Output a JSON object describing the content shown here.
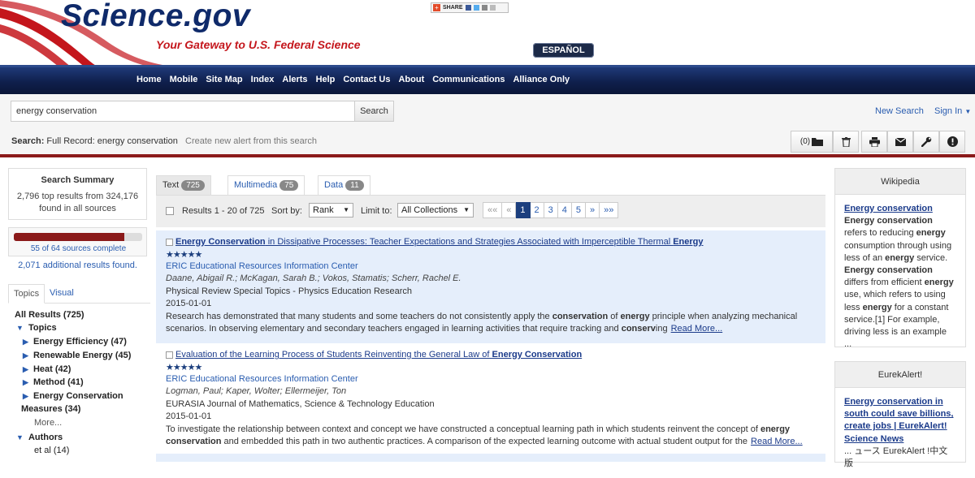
{
  "site": {
    "logo": "Science.gov",
    "tagline": "Your Gateway to U.S. Federal Science",
    "share_label": "SHARE",
    "espanol": "ESPAÑOL"
  },
  "nav": [
    "Home",
    "Mobile",
    "Site Map",
    "Index",
    "Alerts",
    "Help",
    "Contact Us",
    "About",
    "Communications",
    "Alliance Only"
  ],
  "search": {
    "query": "energy conservation",
    "button": "Search",
    "new_search": "New Search",
    "sign_in": "Sign In",
    "label_prefix": "Search:",
    "label_value": "Full Record: energy conservation",
    "create_alert": "Create new alert from this search",
    "saved_count": "(0)"
  },
  "colors": {
    "brand_navy": "#0f2a6a",
    "accent_red": "#c4161c",
    "divider": "#8b1a1a",
    "link": "#2a5db0",
    "highlight": "#e5eefb"
  },
  "toolbar_icons": [
    "folder-icon",
    "trash-icon",
    "print-icon",
    "email-icon",
    "wrench-icon",
    "info-icon"
  ],
  "summary": {
    "title": "Search Summary",
    "text": "2,796 top results from 324,176 found in all sources",
    "progress_text": "55 of 64 sources complete",
    "progress_fraction": 0.86,
    "additional": "2,071 additional results found."
  },
  "side_tabs": [
    "Topics",
    "Visual"
  ],
  "facets": {
    "all_results": "All Results (725)",
    "topics_label": "Topics",
    "topics": [
      "Energy Efficiency (47)",
      "Renewable Energy (45)",
      "Heat (42)",
      "Method (41)",
      "Energy Conservation"
    ],
    "topics_wrap": "Measures (34)",
    "more": "More...",
    "authors_label": "Authors",
    "authors": [
      "et al (14)"
    ]
  },
  "result_tabs": [
    {
      "label": "Text",
      "count": "725"
    },
    {
      "label": "Multimedia",
      "count": "75"
    },
    {
      "label": "Data",
      "count": "11"
    }
  ],
  "results_bar": {
    "count": "Results 1 - 20 of 725",
    "sort_label": "Sort by:",
    "sort_value": "Rank",
    "limit_label": "Limit to:",
    "limit_value": "All Collections",
    "pages": [
      "««",
      "«",
      "1",
      "2",
      "3",
      "4",
      "5",
      "»",
      "»»"
    ],
    "active_page": "1"
  },
  "results": [
    {
      "title_b1": "Energy Conservation",
      "title_mid": " in Dissipative Processes: Teacher Expectations and Strategies Associated with Imperceptible Thermal ",
      "title_b2": "Energy",
      "title_end": "",
      "stars": "★★★★★",
      "source": "ERIC Educational Resources Information Center",
      "authors": "Daane, Abigail R.; McKagan, Sarah B.; Vokos, Stamatis; Scherr, Rachel E.",
      "journal": "Physical Review Special Topics - Physics Education Research",
      "date": "2015-01-01",
      "abs1": "Research has demonstrated that many students and some teachers do not consistently apply the ",
      "abs_b1": "conservation",
      "abs2": " of ",
      "abs_b2": "energy",
      "abs3": " principle when analyzing mechanical scenarios. In observing elementary and secondary teachers engaged in learning activities that require tracking and ",
      "abs_b3": "conserv",
      "abs4": "ing",
      "read_more": "Read More..."
    },
    {
      "title_b1": "",
      "title_mid": "Evaluation of the Learning Process of Students Reinventing the General Law of ",
      "title_b2": "Energy Conservation",
      "title_end": "",
      "stars": "★★★★★",
      "source": "ERIC Educational Resources Information Center",
      "authors": "Logman, Paul; Kaper, Wolter; Ellermeijer, Ton",
      "journal": "EURASIA Journal of Mathematics, Science & Technology Education",
      "date": "2015-01-01",
      "abs1": "To investigate the relationship between context and concept we have constructed a conceptual learning path in which students reinvent the concept of ",
      "abs_b1": "energy conservation",
      "abs2": " and embedded this path in two authentic practices. A comparison of the expected learning outcome with actual student output for the",
      "abs_b2": "",
      "abs3": "",
      "abs_b3": "",
      "abs4": "",
      "read_more": "Read More..."
    }
  ],
  "wikipedia": {
    "title": "Wikipedia",
    "link": "Energy conservation",
    "t1b": "Energy conservation",
    "t1": " refers to reducing ",
    "t2b": "energy",
    "t2": " consumption through using less of an ",
    "t3b": "energy",
    "t3": " service. ",
    "t4b": "Energy conservation",
    "t4": " differs from efficient ",
    "t5b": "energy",
    "t5": " use, which refers to using less ",
    "t6b": "energy",
    "t6": " for a constant service.[1] For example, driving less is an example ..."
  },
  "eurekalert": {
    "title": "EurekAlert!",
    "link_b": "Energy conservation",
    "link_rest": " in south could save billions, create jobs | EurekAlert! Science News",
    "text": "... ュース EurekAlert !中文版"
  }
}
